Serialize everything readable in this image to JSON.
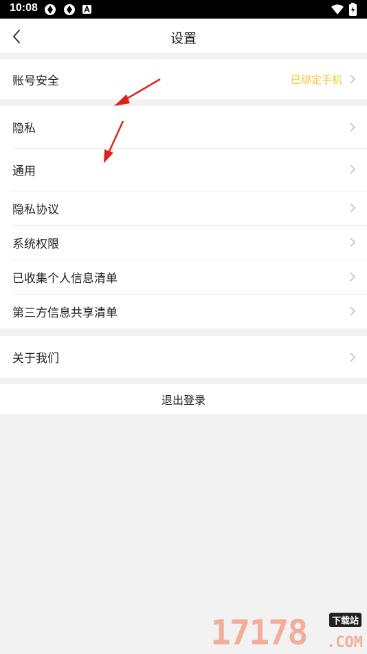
{
  "status_bar": {
    "time": "10:08",
    "icons": [
      "vpn-icon",
      "vpn-icon",
      "accessibility-icon",
      "wifi-icon",
      "battery-icon"
    ]
  },
  "nav": {
    "title": "设置",
    "back_icon": "back-arrow-icon"
  },
  "groups": {
    "account": [
      {
        "label": "账号安全",
        "value": "已绑定手机"
      }
    ],
    "general": [
      {
        "label": "隐私"
      },
      {
        "label": "通用"
      },
      {
        "label": "隐私协议"
      },
      {
        "label": "系统权限"
      },
      {
        "label": "已收集个人信息清单"
      },
      {
        "label": "第三方信息共享清单"
      }
    ],
    "about": [
      {
        "label": "关于我们"
      }
    ]
  },
  "logout": {
    "label": "退出登录"
  },
  "watermark": {
    "digits": "17178",
    "badge": "下载站",
    "suffix": ".COM"
  },
  "colors": {
    "accent": "#f4c430",
    "background": "#f2f2f2",
    "arrow": "#e0211b"
  }
}
